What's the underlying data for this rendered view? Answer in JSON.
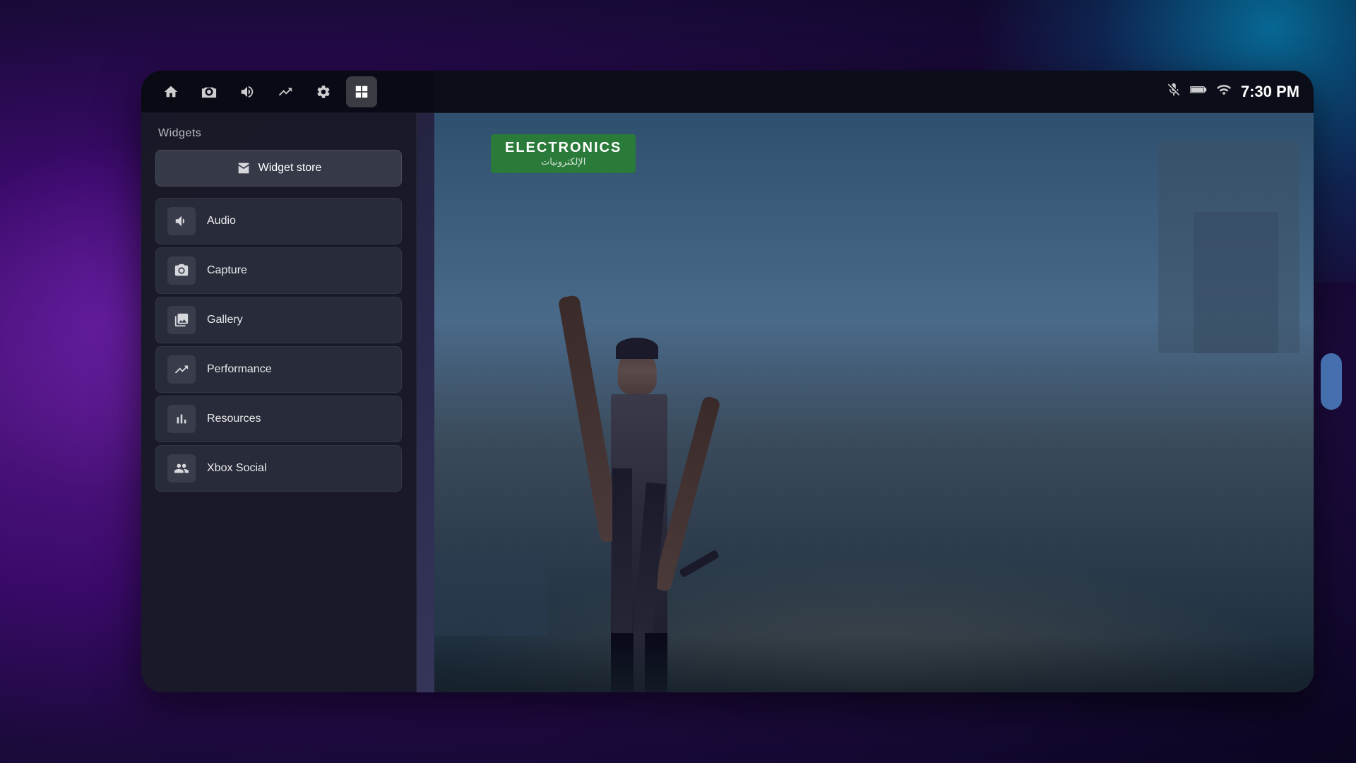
{
  "background": {
    "color_start": "#5a1a8a",
    "color_end": "#0a0520"
  },
  "taskbar": {
    "icons": [
      {
        "name": "home-icon",
        "label": "Home",
        "active": false
      },
      {
        "name": "camera-icon",
        "label": "Capture",
        "active": false
      },
      {
        "name": "volume-icon",
        "label": "Audio",
        "active": false
      },
      {
        "name": "performance-icon",
        "label": "Performance",
        "active": false
      },
      {
        "name": "settings-icon",
        "label": "Settings",
        "active": false
      },
      {
        "name": "widgets-icon",
        "label": "Widgets",
        "active": true
      }
    ],
    "status": {
      "mic_muted": true,
      "battery": "full",
      "wifi": "connected",
      "time": "7:30 PM"
    }
  },
  "widget_panel": {
    "title": "Widgets",
    "store_button_label": "Widget store",
    "items": [
      {
        "id": "audio",
        "label": "Audio",
        "icon": "audio"
      },
      {
        "id": "capture",
        "label": "Capture",
        "icon": "capture"
      },
      {
        "id": "gallery",
        "label": "Gallery",
        "icon": "gallery"
      },
      {
        "id": "performance",
        "label": "Performance",
        "icon": "performance"
      },
      {
        "id": "resources",
        "label": "Resources",
        "icon": "resources"
      },
      {
        "id": "xbox-social",
        "label": "Xbox Social",
        "icon": "social"
      }
    ]
  },
  "scene": {
    "store_name": "ELECTRONICS",
    "store_name_arabic": "الإلكترونيات"
  }
}
